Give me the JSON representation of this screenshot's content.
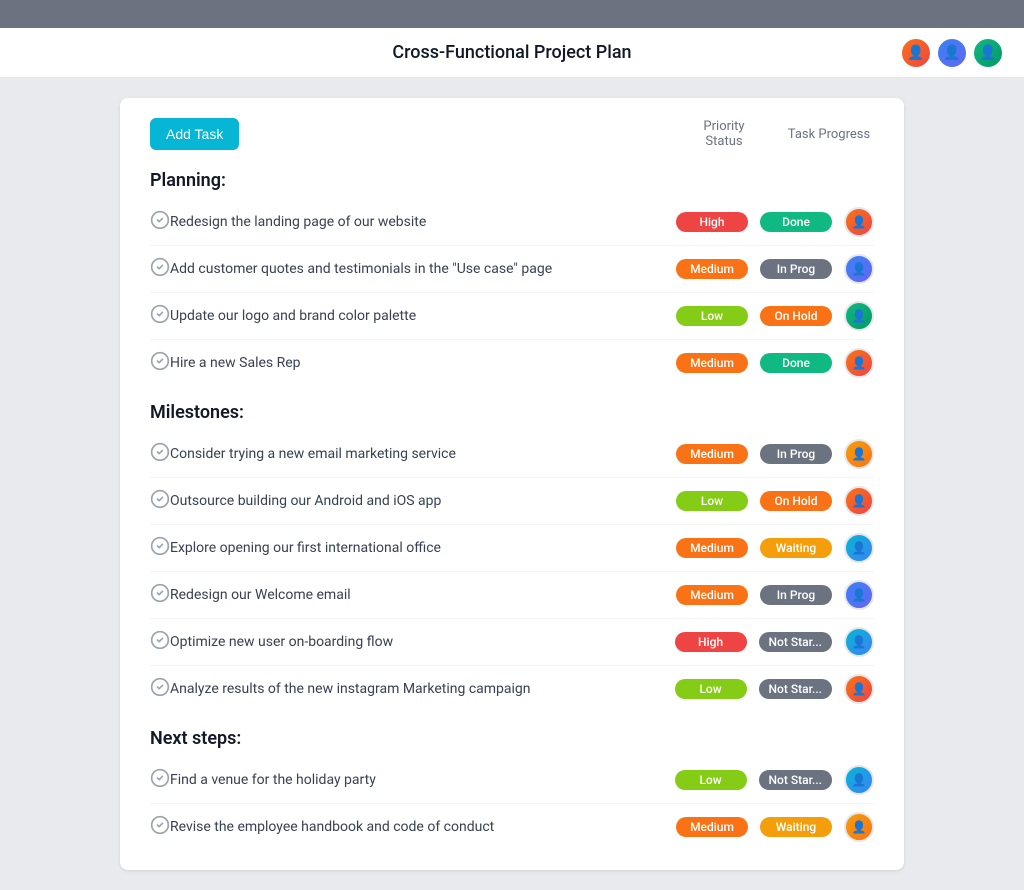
{
  "app": {
    "title": "Cross-Functional Project Plan"
  },
  "header": {
    "add_task_label": "Add Task",
    "col_priority": "Priority Status",
    "col_progress": "Task Progress"
  },
  "sections": [
    {
      "title": "Planning:",
      "tasks": [
        {
          "name": "Redesign the landing page of our website",
          "priority": "High",
          "priority_class": "badge-high",
          "status": "Done",
          "status_class": "status-done",
          "avatar_class": "av-orange"
        },
        {
          "name": "Add customer quotes and testimonials in the \"Use case\" page",
          "priority": "Medium",
          "priority_class": "badge-medium",
          "status": "In Prog",
          "status_class": "status-inprog",
          "avatar_class": "av-blue"
        },
        {
          "name": "Update our logo and brand color palette",
          "priority": "Low",
          "priority_class": "badge-low",
          "status": "On Hold",
          "status_class": "status-onhold",
          "avatar_class": "av-green"
        },
        {
          "name": "Hire a new Sales Rep",
          "priority": "Medium",
          "priority_class": "badge-medium",
          "status": "Done",
          "status_class": "status-done",
          "avatar_class": "av-orange"
        }
      ]
    },
    {
      "title": "Milestones:",
      "tasks": [
        {
          "name": "Consider trying a new email marketing service",
          "priority": "Medium",
          "priority_class": "badge-medium",
          "status": "In Prog",
          "status_class": "status-inprog",
          "avatar_class": "av-yellow"
        },
        {
          "name": "Outsource building our Android and iOS app",
          "priority": "Low",
          "priority_class": "badge-low",
          "status": "On Hold",
          "status_class": "status-onhold",
          "avatar_class": "av-orange"
        },
        {
          "name": "Explore opening our first international office",
          "priority": "Medium",
          "priority_class": "badge-medium",
          "status": "Waiting",
          "status_class": "status-waiting",
          "avatar_class": "av-teal"
        },
        {
          "name": "Redesign our Welcome email",
          "priority": "Medium",
          "priority_class": "badge-medium",
          "status": "In Prog",
          "status_class": "status-inprog",
          "avatar_class": "av-blue"
        },
        {
          "name": "Optimize new user on-boarding flow",
          "priority": "High",
          "priority_class": "badge-high",
          "status": "Not Star...",
          "status_class": "status-notstart",
          "avatar_class": "av-teal"
        },
        {
          "name": "Analyze results of the new instagram Marketing campaign",
          "priority": "Low",
          "priority_class": "badge-low",
          "status": "Not Star...",
          "status_class": "status-notstart",
          "avatar_class": "av-orange"
        }
      ]
    },
    {
      "title": "Next steps:",
      "tasks": [
        {
          "name": "Find a venue for the holiday party",
          "priority": "Low",
          "priority_class": "badge-low",
          "status": "Not Star...",
          "status_class": "status-notstart",
          "avatar_class": "av-teal"
        },
        {
          "name": "Revise the employee handbook and code of conduct",
          "priority": "Medium",
          "priority_class": "badge-medium",
          "status": "Waiting",
          "status_class": "status-waiting",
          "avatar_class": "av-yellow"
        }
      ]
    }
  ]
}
